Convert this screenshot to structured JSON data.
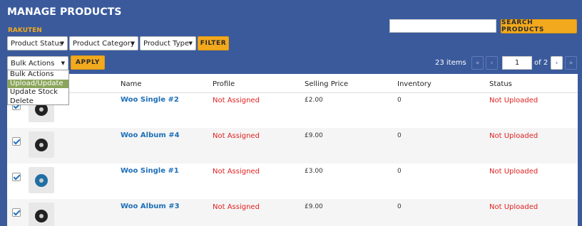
{
  "header": {
    "title": "MANAGE PRODUCTS",
    "subtitle": "RAKUTEN"
  },
  "search": {
    "value": "",
    "button_label": "SEARCH PRODUCTS"
  },
  "filters": {
    "product_status": "Product Status",
    "product_category": "Product Category",
    "product_type": "Product Type",
    "filter_label": "FILTER"
  },
  "bulk": {
    "selected": "Bulk Actions",
    "apply_label": "APPLY",
    "options": [
      "Bulk Actions",
      "Upload/Update",
      "Update Stock",
      "Delete"
    ],
    "highlighted_option": "Upload/Update"
  },
  "pagination": {
    "items": "23 items",
    "first": "«",
    "prev": "‹",
    "current": "1",
    "of": "of 2",
    "next": "›",
    "last": "»"
  },
  "table": {
    "columns": [
      "Name",
      "Profile",
      "Selling Price",
      "Inventory",
      "Status"
    ],
    "rows": [
      {
        "name": "Woo Single #2",
        "profile": "Not Assigned",
        "price": "£2.00",
        "inventory": "0",
        "status": "Not Uploaded",
        "checked": true,
        "disc": "dark"
      },
      {
        "name": "Woo Album #4",
        "profile": "Not Assigned",
        "price": "£9.00",
        "inventory": "0",
        "status": "Not Uploaded",
        "checked": true,
        "disc": "dark"
      },
      {
        "name": "Woo Single #1",
        "profile": "Not Assigned",
        "price": "£3.00",
        "inventory": "0",
        "status": "Not Uploaded",
        "checked": true,
        "disc": "blue"
      },
      {
        "name": "Woo Album #3",
        "profile": "Not Assigned",
        "price": "£9.00",
        "inventory": "0",
        "status": "Not Uploaded",
        "checked": true,
        "disc": "dark"
      }
    ]
  },
  "colors": {
    "header_bg": "#3a5a9c",
    "accent": "#f2a91d",
    "link": "#1d6fb8",
    "status_red": "#e02020",
    "highlight": "#8aa55a"
  }
}
